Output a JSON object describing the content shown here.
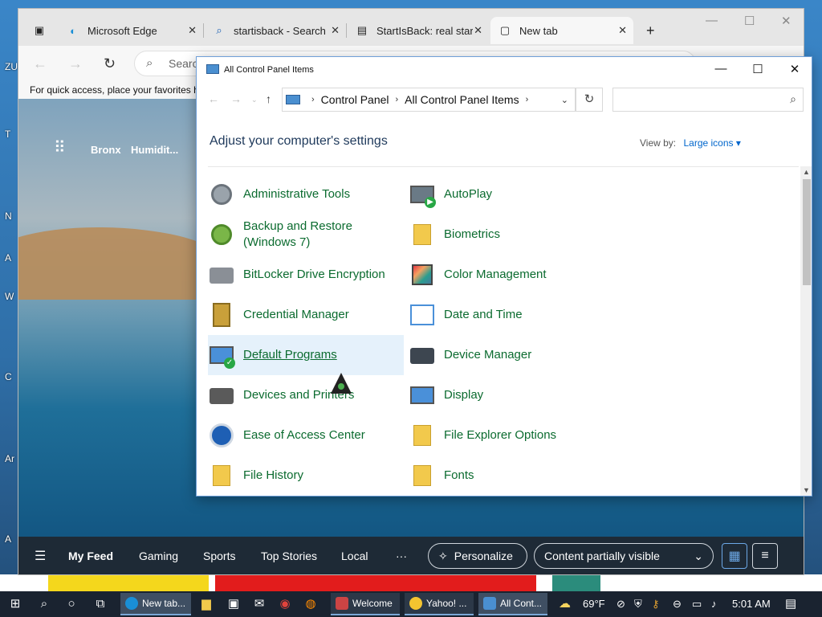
{
  "desktop": {
    "side_labels": [
      "ZU",
      "T",
      "N",
      "A",
      "W",
      "C",
      "Ar",
      "A"
    ]
  },
  "edge": {
    "tabs": [
      {
        "label": "Microsoft Edge",
        "icon": "edge-icon"
      },
      {
        "label": "startisback - Search",
        "icon": "search-icon"
      },
      {
        "label": "StartIsBack: real start",
        "icon": "page-icon"
      },
      {
        "label": "New tab",
        "icon": "new-tab-icon",
        "active": true
      }
    ],
    "address_placeholder": "Search or enter web address",
    "favorites_text": "For quick access, place your favorites h",
    "ntp": {
      "location": "Bronx",
      "humidity": "Humidit..."
    },
    "feed": {
      "my_feed": "My Feed",
      "gaming": "Gaming",
      "sports": "Sports",
      "top_stories": "Top Stories",
      "local": "Local",
      "more": "···",
      "personalize": "Personalize",
      "content": "Content partially visible"
    }
  },
  "control_panel": {
    "title": "All Control Panel Items",
    "breadcrumb": [
      "Control Panel",
      "All Control Panel Items"
    ],
    "search_placeholder": "",
    "heading": "Adjust your computer's settings",
    "view_by_label": "View by:",
    "view_by_value": "Large icons",
    "items": [
      {
        "label": "Administrative Tools",
        "icon": "administrative-tools-icon"
      },
      {
        "label": "AutoPlay",
        "icon": "autoplay-icon"
      },
      {
        "label": "Backup and Restore\n(Windows 7)",
        "icon": "backup-restore-icon"
      },
      {
        "label": "Biometrics",
        "icon": "biometrics-icon"
      },
      {
        "label": "BitLocker Drive Encryption",
        "icon": "bitlocker-icon"
      },
      {
        "label": "Color Management",
        "icon": "color-management-icon"
      },
      {
        "label": "Credential Manager",
        "icon": "credential-manager-icon"
      },
      {
        "label": "Date and Time",
        "icon": "date-time-icon"
      },
      {
        "label": "Default Programs",
        "icon": "default-programs-icon"
      },
      {
        "label": "Device Manager",
        "icon": "device-manager-icon"
      },
      {
        "label": "Devices and Printers",
        "icon": "devices-printers-icon"
      },
      {
        "label": "Display",
        "icon": "display-icon"
      },
      {
        "label": "Ease of Access Center",
        "icon": "ease-of-access-icon"
      },
      {
        "label": "File Explorer Options",
        "icon": "file-explorer-options-icon"
      },
      {
        "label": "File History",
        "icon": "file-history-icon"
      },
      {
        "label": "Fonts",
        "icon": "fonts-icon"
      }
    ]
  },
  "taskbar": {
    "buttons": [
      "New tab...",
      "Welcome",
      "Yahoo! ...",
      "All Cont..."
    ],
    "temperature": "69°F",
    "time": "5:01 AM"
  },
  "colors": {
    "link_green": "#0b6b2f",
    "heading_blue": "#1e395b",
    "hover_bg": "#e5f1fb",
    "taskbar_bg": "#1a2330"
  }
}
